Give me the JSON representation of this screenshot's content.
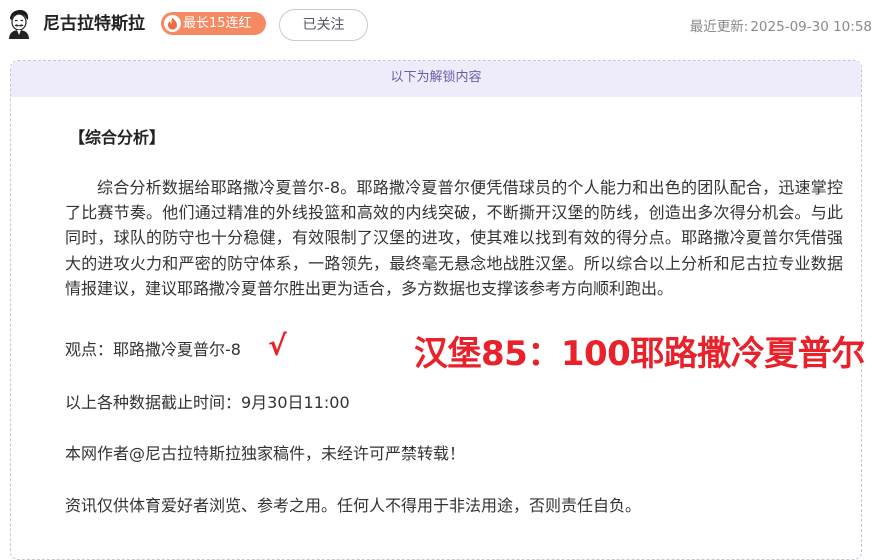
{
  "header": {
    "author_name": "尼古拉特斯拉",
    "streak_badge": "最长15连红",
    "follow_label": "已关注",
    "updated_label": "最近更新:",
    "updated_time": "2025-09-30 10:58"
  },
  "content": {
    "unlock_banner": "以下为解锁内容",
    "section_heading": "【综合分析】",
    "analysis_paragraph": "综合分析数据给耶路撒冷夏普尔-8。耶路撒冷夏普尔便凭借球员的个人能力和出色的团队配合，迅速掌控了比赛节奏。他们通过精准的外线投篮和高效的内线突破，不断撕开汉堡的防线，创造出多次得分机会。与此同时，球队的防守也十分稳健，有效限制了汉堡的进攻，使其难以找到有效的得分点。耶路撒冷夏普尔凭借强大的进攻火力和严密的防守体系，一路领先，最终毫无悬念地战胜汉堡。所以综合以上分析和尼古拉专业数据情报建议，建议耶路撒冷夏普尔胜出更为适合，多方数据也支撑该参考方向顺利跑出。",
    "view_line": "观点：耶路撒冷夏普尔-8",
    "checkmark": "√",
    "score_text": "汉堡85：100耶路撒冷夏普尔",
    "cutoff_line": "以上各种数据截止时间：9月30日11:00",
    "copyright_line": "本网作者@尼古拉特斯拉独家稿件，未经许可严禁转载！",
    "disclaimer_line": "资讯仅供体育爱好者浏览、参考之用。任何人不得用于非法用途，否则责任自负。"
  },
  "colors": {
    "accent_red": "#e8212a",
    "badge_orange": "#f58a62",
    "banner_bg": "#eeebfa",
    "banner_text": "#6a5fa6"
  },
  "icons": {
    "avatar": "tesla-portrait-avatar",
    "badge": "flame-icon"
  }
}
